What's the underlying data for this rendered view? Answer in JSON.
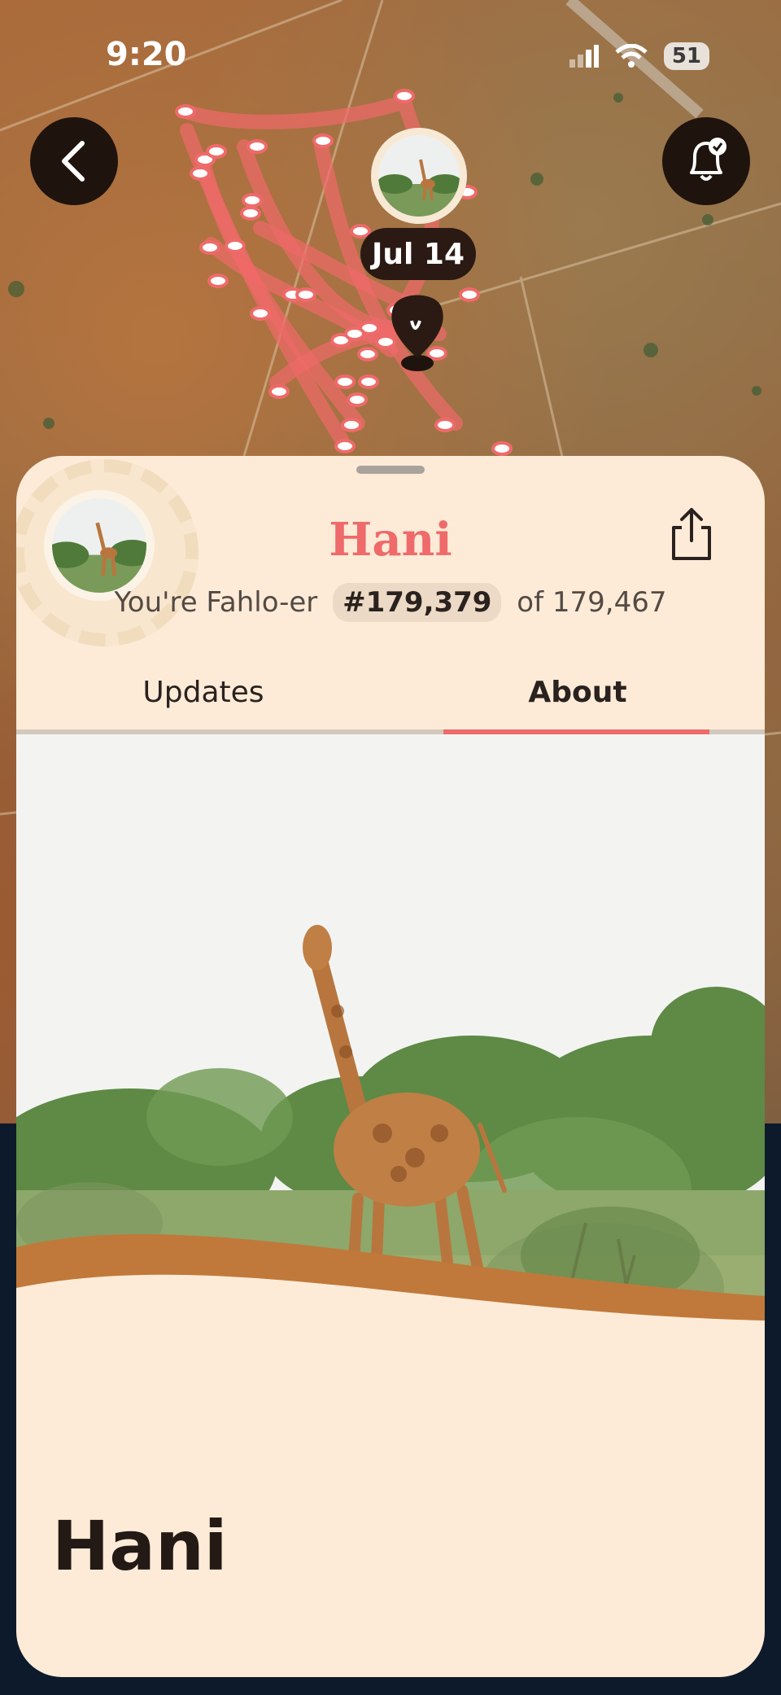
{
  "status_bar": {
    "time": "9:20",
    "battery": "51"
  },
  "map": {
    "date_label": "Jul 14",
    "track_color": "#ef6a6a"
  },
  "profile": {
    "name": "Hani",
    "rank_prefix": "You're Fahlo-er",
    "rank": "#179,379",
    "rank_suffix": "of 179,467"
  },
  "tabs": [
    {
      "label": "Updates",
      "active": false
    },
    {
      "label": "About",
      "active": true
    }
  ],
  "about": {
    "title": "Hani"
  },
  "colors": {
    "accent": "#ef6a6a",
    "sheet_bg": "#fdebd8",
    "dark": "#1f130d",
    "wave": "#c0793a"
  },
  "icons": [
    "back-chevron-icon",
    "bell-check-icon",
    "share-icon",
    "giraffe-icon",
    "location-pin-icon"
  ]
}
